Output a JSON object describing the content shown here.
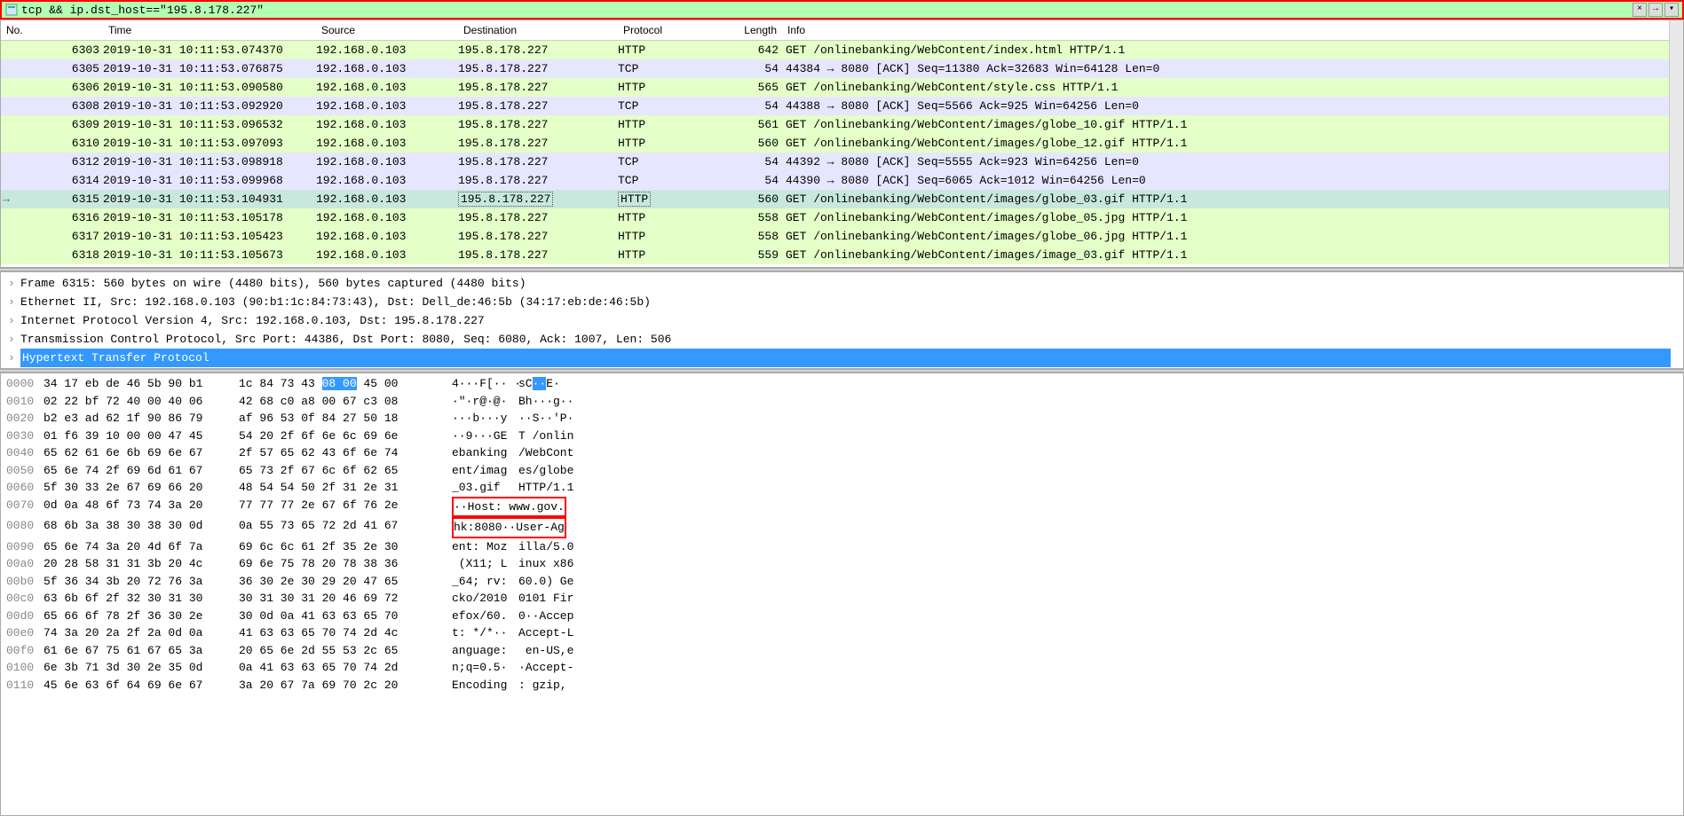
{
  "filter": {
    "text": "tcp && ip.dst_host==\"195.8.178.227\""
  },
  "columns": {
    "no": "No.",
    "time": "Time",
    "source": "Source",
    "destination": "Destination",
    "protocol": "Protocol",
    "length": "Length",
    "info": "Info"
  },
  "packets": [
    {
      "no": "6303",
      "time": "2019-10-31 10:11:53.074370",
      "src": "192.168.0.103",
      "dst": "195.8.178.227",
      "proto": "HTTP",
      "len": "642",
      "info": "GET /onlinebanking/WebContent/index.html HTTP/1.1",
      "cls": "row-http"
    },
    {
      "no": "6305",
      "time": "2019-10-31 10:11:53.076875",
      "src": "192.168.0.103",
      "dst": "195.8.178.227",
      "proto": "TCP",
      "len": "54",
      "info": "44384 → 8080 [ACK] Seq=11380 Ack=32683 Win=64128 Len=0",
      "cls": "row-tcp"
    },
    {
      "no": "6306",
      "time": "2019-10-31 10:11:53.090580",
      "src": "192.168.0.103",
      "dst": "195.8.178.227",
      "proto": "HTTP",
      "len": "565",
      "info": "GET /onlinebanking/WebContent/style.css HTTP/1.1",
      "cls": "row-http"
    },
    {
      "no": "6308",
      "time": "2019-10-31 10:11:53.092920",
      "src": "192.168.0.103",
      "dst": "195.8.178.227",
      "proto": "TCP",
      "len": "54",
      "info": "44388 → 8080 [ACK] Seq=5566 Ack=925 Win=64256 Len=0",
      "cls": "row-tcp"
    },
    {
      "no": "6309",
      "time": "2019-10-31 10:11:53.096532",
      "src": "192.168.0.103",
      "dst": "195.8.178.227",
      "proto": "HTTP",
      "len": "561",
      "info": "GET /onlinebanking/WebContent/images/globe_10.gif HTTP/1.1",
      "cls": "row-http"
    },
    {
      "no": "6310",
      "time": "2019-10-31 10:11:53.097093",
      "src": "192.168.0.103",
      "dst": "195.8.178.227",
      "proto": "HTTP",
      "len": "560",
      "info": "GET /onlinebanking/WebContent/images/globe_12.gif HTTP/1.1",
      "cls": "row-http"
    },
    {
      "no": "6312",
      "time": "2019-10-31 10:11:53.098918",
      "src": "192.168.0.103",
      "dst": "195.8.178.227",
      "proto": "TCP",
      "len": "54",
      "info": "44392 → 8080 [ACK] Seq=5555 Ack=923 Win=64256 Len=0",
      "cls": "row-tcp"
    },
    {
      "no": "6314",
      "time": "2019-10-31 10:11:53.099968",
      "src": "192.168.0.103",
      "dst": "195.8.178.227",
      "proto": "TCP",
      "len": "54",
      "info": "44390 → 8080 [ACK] Seq=6065 Ack=1012 Win=64256 Len=0",
      "cls": "row-tcp"
    },
    {
      "no": "6315",
      "time": "2019-10-31 10:11:53.104931",
      "src": "192.168.0.103",
      "dst": "195.8.178.227",
      "proto": "HTTP",
      "len": "560",
      "info": "GET /onlinebanking/WebContent/images/globe_03.gif HTTP/1.1",
      "cls": "row-http row-selected",
      "sel": true
    },
    {
      "no": "6316",
      "time": "2019-10-31 10:11:53.105178",
      "src": "192.168.0.103",
      "dst": "195.8.178.227",
      "proto": "HTTP",
      "len": "558",
      "info": "GET /onlinebanking/WebContent/images/globe_05.jpg HTTP/1.1",
      "cls": "row-http"
    },
    {
      "no": "6317",
      "time": "2019-10-31 10:11:53.105423",
      "src": "192.168.0.103",
      "dst": "195.8.178.227",
      "proto": "HTTP",
      "len": "558",
      "info": "GET /onlinebanking/WebContent/images/globe_06.jpg HTTP/1.1",
      "cls": "row-http"
    },
    {
      "no": "6318",
      "time": "2019-10-31 10:11:53.105673",
      "src": "192.168.0.103",
      "dst": "195.8.178.227",
      "proto": "HTTP",
      "len": "559",
      "info": "GET /onlinebanking/WebContent/images/image_03.gif HTTP/1.1",
      "cls": "row-http"
    }
  ],
  "details": [
    {
      "text": "Frame 6315: 560 bytes on wire (4480 bits), 560 bytes captured (4480 bits)"
    },
    {
      "text": "Ethernet II, Src: 192.168.0.103 (90:b1:1c:84:73:43), Dst: Dell_de:46:5b (34:17:eb:de:46:5b)"
    },
    {
      "text": "Internet Protocol Version 4, Src: 192.168.0.103, Dst: 195.8.178.227"
    },
    {
      "text": "Transmission Control Protocol, Src Port: 44386, Dst Port: 8080, Seq: 6080, Ack: 1007, Len: 506"
    },
    {
      "text": "Hypertext Transfer Protocol",
      "selected": true
    }
  ],
  "hex": [
    {
      "off": "0000",
      "b1": "34 17 eb de 46 5b 90 b1",
      "b2": "1c 84 73 43 ",
      "bh": "08 00",
      "b3": " 45 00",
      "a1": "4···F[·· ·",
      "ah": "·",
      "ah2": "sC",
      "ah3": "·",
      "ah4": "·",
      "a2": "E·"
    },
    {
      "off": "0010",
      "b1": "02 22 bf 72 40 00 40 06",
      "b2": "42 68 c0 a8 00 67 c3 08",
      "a1": "·\"·r@·@·",
      "a2": "Bh···g··"
    },
    {
      "off": "0020",
      "b1": "b2 e3 ad 62 1f 90 86 79",
      "b2": "af 96 53 0f 84 27 50 18",
      "a1": "···b···y",
      "a2": "··S··'P·"
    },
    {
      "off": "0030",
      "b1": "01 f6 39 10 00 00 47 45",
      "b2": "54 20 2f 6f 6e 6c 69 6e",
      "a1": "··9···GE",
      "a2": "T /onlin"
    },
    {
      "off": "0040",
      "b1": "65 62 61 6e 6b 69 6e 67",
      "b2": "2f 57 65 62 43 6f 6e 74",
      "a1": "ebanking",
      "a2": "/WebCont"
    },
    {
      "off": "0050",
      "b1": "65 6e 74 2f 69 6d 61 67",
      "b2": "65 73 2f 67 6c 6f 62 65",
      "a1": "ent/imag",
      "a2": "es/globe"
    },
    {
      "off": "0060",
      "b1": "5f 30 33 2e 67 69 66 20",
      "b2": "48 54 54 50 2f 31 2e 31",
      "a1": "_03.gif ",
      "a2": "HTTP/1.1"
    },
    {
      "off": "0070",
      "b1": "0d 0a 48 6f 73 74 3a 20",
      "b2": "77 77 77 2e 67 6f 76 2e",
      "a1": "··Host: ",
      "a2": "www.gov.",
      "boxed": true
    },
    {
      "off": "0080",
      "b1": "68 6b 3a 38 30 38 30 0d",
      "b2": "0a 55 73 65 72 2d 41 67",
      "a1": "hk:8080·",
      "a2": "·User-Ag",
      "boxed": true
    },
    {
      "off": "0090",
      "b1": "65 6e 74 3a 20 4d 6f 7a",
      "b2": "69 6c 6c 61 2f 35 2e 30",
      "a1": "ent: Moz",
      "a2": "illa/5.0"
    },
    {
      "off": "00a0",
      "b1": "20 28 58 31 31 3b 20 4c",
      "b2": "69 6e 75 78 20 78 38 36",
      "a1": " (X11; L",
      "a2": "inux x86"
    },
    {
      "off": "00b0",
      "b1": "5f 36 34 3b 20 72 76 3a",
      "b2": "36 30 2e 30 29 20 47 65",
      "a1": "_64; rv:",
      "a2": "60.0) Ge"
    },
    {
      "off": "00c0",
      "b1": "63 6b 6f 2f 32 30 31 30",
      "b2": "30 31 30 31 20 46 69 72",
      "a1": "cko/2010",
      "a2": "0101 Fir"
    },
    {
      "off": "00d0",
      "b1": "65 66 6f 78 2f 36 30 2e",
      "b2": "30 0d 0a 41 63 63 65 70",
      "a1": "efox/60.",
      "a2": "0··Accep"
    },
    {
      "off": "00e0",
      "b1": "74 3a 20 2a 2f 2a 0d 0a",
      "b2": "41 63 63 65 70 74 2d 4c",
      "a1": "t: */*··",
      "a2": "Accept-L"
    },
    {
      "off": "00f0",
      "b1": "61 6e 67 75 61 67 65 3a",
      "b2": "20 65 6e 2d 55 53 2c 65",
      "a1": "anguage:",
      "a2": " en-US,e"
    },
    {
      "off": "0100",
      "b1": "6e 3b 71 3d 30 2e 35 0d",
      "b2": "0a 41 63 63 65 70 74 2d",
      "a1": "n;q=0.5·",
      "a2": "·Accept-"
    },
    {
      "off": "0110",
      "b1": "45 6e 63 6f 64 69 6e 67",
      "b2": "3a 20 67 7a 69 70 2c 20",
      "a1": "Encoding",
      "a2": ": gzip, "
    }
  ]
}
